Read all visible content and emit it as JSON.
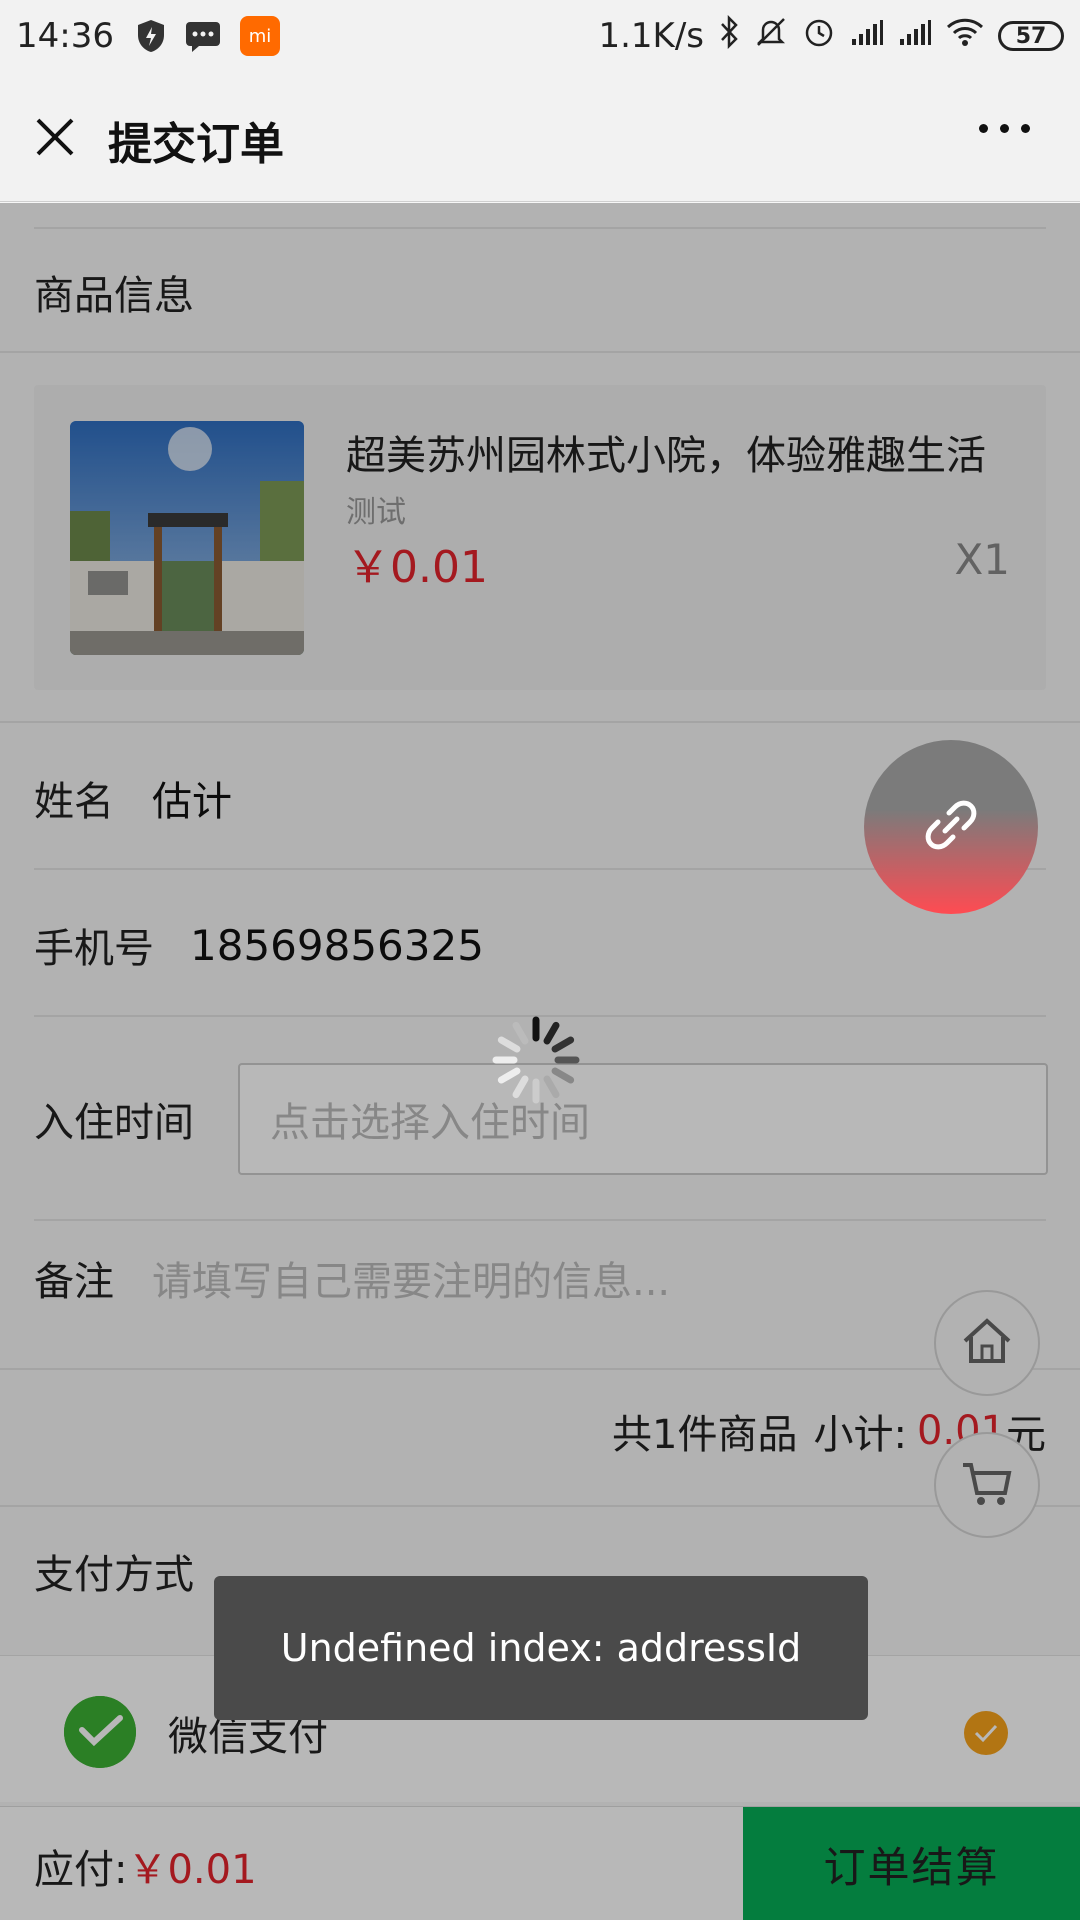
{
  "status_bar": {
    "time": "14:36",
    "mi_badge": "mi",
    "network_speed": "1.1K/s",
    "battery": "57",
    "icons": [
      "shield-icon",
      "message-icon",
      "mi-icon",
      "bluetooth-icon",
      "mute-icon",
      "alarm-icon",
      "signal-icon",
      "signal-icon",
      "wifi-icon",
      "battery-icon"
    ]
  },
  "nav": {
    "title": "提交订单",
    "close_icon": "close-icon",
    "more_icon": "more-icon"
  },
  "goods_section": {
    "title": "商品信息",
    "item": {
      "name": "超美苏州园林式小院，体验雅趣生活",
      "sub": "测试",
      "price": "￥0.01",
      "qty": "X1"
    }
  },
  "form": {
    "name_label": "姓名",
    "name_value": "估计",
    "phone_label": "手机号",
    "phone_value": "18569856325",
    "checkin_label": "入住时间",
    "checkin_placeholder": "点击选择入住时间",
    "note_label": "备注",
    "note_placeholder": "请填写自己需要注明的信息..."
  },
  "summary": {
    "count_text": "共1件商品",
    "subtotal_label": "小计:",
    "subtotal_value": "0.01",
    "unit": "元"
  },
  "payment": {
    "title": "支付方式",
    "method": "微信支付",
    "selected": true
  },
  "bottom_bar": {
    "due_label": "应付:",
    "due_amount": "￥0.01",
    "submit_label": "订单结算"
  },
  "toast": {
    "message": "Undefined index: addressId"
  },
  "colors": {
    "price_red": "#e3232c",
    "wechat_green": "#3cb034",
    "submit_green": "#06ad56",
    "check_orange": "#f7a21b"
  }
}
